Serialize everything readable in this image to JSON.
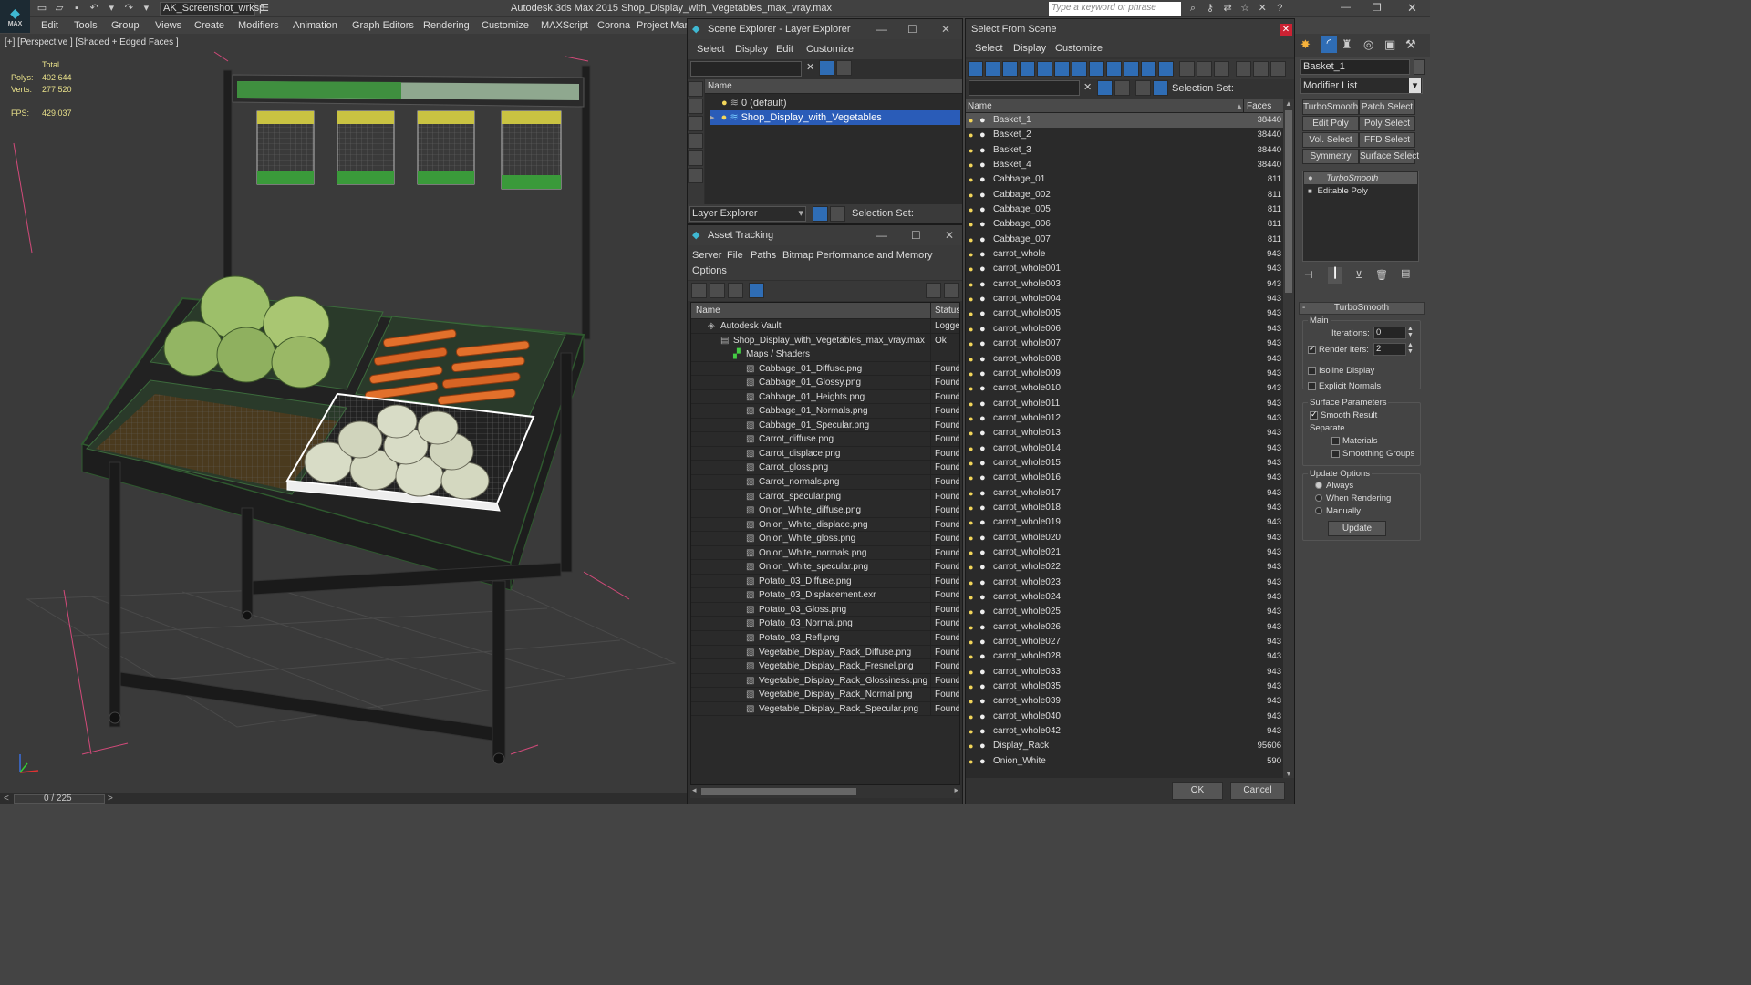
{
  "app": {
    "logo_text": "MAX",
    "workspace": "AK_Screenshot_wrksp",
    "title": "Autodesk 3ds Max 2015    Shop_Display_with_Vegetables_max_vray.max",
    "search_placeholder": "Type a keyword or phrase"
  },
  "menus": [
    "Edit",
    "Tools",
    "Group",
    "Views",
    "Create",
    "Modifiers",
    "Animation",
    "Graph Editors",
    "Rendering",
    "Customize",
    "MAXScript",
    "Corona",
    "Project Man"
  ],
  "viewport": {
    "label": "[+] [Perspective ] [Shaded + Edged Faces ]",
    "stats": {
      "total_label": "Total",
      "polys_label": "Polys:",
      "polys_value": "402 644",
      "verts_label": "Verts:",
      "verts_value": "277 520",
      "fps_label": "FPS:",
      "fps_value": "429,037"
    }
  },
  "statusbar": {
    "timeline": "0 / 225"
  },
  "scene_explorer": {
    "title": "Scene Explorer - Layer Explorer",
    "menus": [
      "Select",
      "Display",
      "Edit",
      "Customize"
    ],
    "column": "Name",
    "layers": [
      "0 (default)",
      "Shop_Display_with_Vegetables"
    ],
    "footer_dropdown": "Layer Explorer",
    "footer_selset": "Selection Set:"
  },
  "asset_tracking": {
    "title": "Asset Tracking",
    "menus": [
      "Server",
      "File",
      "Paths",
      "Bitmap Performance and Memory"
    ],
    "menus2": [
      "Options"
    ],
    "col_name": "Name",
    "col_status": "Status",
    "rows": [
      {
        "name": "Autodesk Vault",
        "status": "Logged",
        "indent": 0
      },
      {
        "name": "Shop_Display_with_Vegetables_max_vray.max",
        "status": "Ok",
        "indent": 1
      },
      {
        "name": "Maps / Shaders",
        "status": "",
        "indent": 2
      },
      {
        "name": "Cabbage_01_Diffuse.png",
        "status": "Found",
        "indent": 3
      },
      {
        "name": "Cabbage_01_Glossy.png",
        "status": "Found",
        "indent": 3
      },
      {
        "name": "Cabbage_01_Heights.png",
        "status": "Found",
        "indent": 3
      },
      {
        "name": "Cabbage_01_Normals.png",
        "status": "Found",
        "indent": 3
      },
      {
        "name": "Cabbage_01_Specular.png",
        "status": "Found",
        "indent": 3
      },
      {
        "name": "Carrot_diffuse.png",
        "status": "Found",
        "indent": 3
      },
      {
        "name": "Carrot_displace.png",
        "status": "Found",
        "indent": 3
      },
      {
        "name": "Carrot_gloss.png",
        "status": "Found",
        "indent": 3
      },
      {
        "name": "Carrot_normals.png",
        "status": "Found",
        "indent": 3
      },
      {
        "name": "Carrot_specular.png",
        "status": "Found",
        "indent": 3
      },
      {
        "name": "Onion_White_diffuse.png",
        "status": "Found",
        "indent": 3
      },
      {
        "name": "Onion_White_displace.png",
        "status": "Found",
        "indent": 3
      },
      {
        "name": "Onion_White_gloss.png",
        "status": "Found",
        "indent": 3
      },
      {
        "name": "Onion_White_normals.png",
        "status": "Found",
        "indent": 3
      },
      {
        "name": "Onion_White_specular.png",
        "status": "Found",
        "indent": 3
      },
      {
        "name": "Potato_03_Diffuse.png",
        "status": "Found",
        "indent": 3
      },
      {
        "name": "Potato_03_Displacement.exr",
        "status": "Found",
        "indent": 3
      },
      {
        "name": "Potato_03_Gloss.png",
        "status": "Found",
        "indent": 3
      },
      {
        "name": "Potato_03_Normal.png",
        "status": "Found",
        "indent": 3
      },
      {
        "name": "Potato_03_Refl.png",
        "status": "Found",
        "indent": 3
      },
      {
        "name": "Vegetable_Display_Rack_Diffuse.png",
        "status": "Found",
        "indent": 3
      },
      {
        "name": "Vegetable_Display_Rack_Fresnel.png",
        "status": "Found",
        "indent": 3
      },
      {
        "name": "Vegetable_Display_Rack_Glossiness.png",
        "status": "Found",
        "indent": 3
      },
      {
        "name": "Vegetable_Display_Rack_Normal.png",
        "status": "Found",
        "indent": 3
      },
      {
        "name": "Vegetable_Display_Rack_Specular.png",
        "status": "Found",
        "indent": 3
      }
    ]
  },
  "select_from_scene": {
    "title": "Select From Scene",
    "menus": [
      "Select",
      "Display",
      "Customize"
    ],
    "selset": "Selection Set:",
    "col_name": "Name",
    "col_faces": "Faces",
    "rows": [
      {
        "name": "Basket_1",
        "faces": "38440"
      },
      {
        "name": "Basket_2",
        "faces": "38440"
      },
      {
        "name": "Basket_3",
        "faces": "38440"
      },
      {
        "name": "Basket_4",
        "faces": "38440"
      },
      {
        "name": "Cabbage_01",
        "faces": "811"
      },
      {
        "name": "Cabbage_002",
        "faces": "811"
      },
      {
        "name": "Cabbage_005",
        "faces": "811"
      },
      {
        "name": "Cabbage_006",
        "faces": "811"
      },
      {
        "name": "Cabbage_007",
        "faces": "811"
      },
      {
        "name": "carrot_whole",
        "faces": "943"
      },
      {
        "name": "carrot_whole001",
        "faces": "943"
      },
      {
        "name": "carrot_whole003",
        "faces": "943"
      },
      {
        "name": "carrot_whole004",
        "faces": "943"
      },
      {
        "name": "carrot_whole005",
        "faces": "943"
      },
      {
        "name": "carrot_whole006",
        "faces": "943"
      },
      {
        "name": "carrot_whole007",
        "faces": "943"
      },
      {
        "name": "carrot_whole008",
        "faces": "943"
      },
      {
        "name": "carrot_whole009",
        "faces": "943"
      },
      {
        "name": "carrot_whole010",
        "faces": "943"
      },
      {
        "name": "carrot_whole011",
        "faces": "943"
      },
      {
        "name": "carrot_whole012",
        "faces": "943"
      },
      {
        "name": "carrot_whole013",
        "faces": "943"
      },
      {
        "name": "carrot_whole014",
        "faces": "943"
      },
      {
        "name": "carrot_whole015",
        "faces": "943"
      },
      {
        "name": "carrot_whole016",
        "faces": "943"
      },
      {
        "name": "carrot_whole017",
        "faces": "943"
      },
      {
        "name": "carrot_whole018",
        "faces": "943"
      },
      {
        "name": "carrot_whole019",
        "faces": "943"
      },
      {
        "name": "carrot_whole020",
        "faces": "943"
      },
      {
        "name": "carrot_whole021",
        "faces": "943"
      },
      {
        "name": "carrot_whole022",
        "faces": "943"
      },
      {
        "name": "carrot_whole023",
        "faces": "943"
      },
      {
        "name": "carrot_whole024",
        "faces": "943"
      },
      {
        "name": "carrot_whole025",
        "faces": "943"
      },
      {
        "name": "carrot_whole026",
        "faces": "943"
      },
      {
        "name": "carrot_whole027",
        "faces": "943"
      },
      {
        "name": "carrot_whole028",
        "faces": "943"
      },
      {
        "name": "carrot_whole033",
        "faces": "943"
      },
      {
        "name": "carrot_whole035",
        "faces": "943"
      },
      {
        "name": "carrot_whole039",
        "faces": "943"
      },
      {
        "name": "carrot_whole040",
        "faces": "943"
      },
      {
        "name": "carrot_whole042",
        "faces": "943"
      },
      {
        "name": "Display_Rack",
        "faces": "95606"
      },
      {
        "name": "Onion_White",
        "faces": "590"
      }
    ],
    "ok": "OK",
    "cancel": "Cancel"
  },
  "command_panel": {
    "object_name": "Basket_1",
    "modifier_list": "Modifier List",
    "buttons": [
      "TurboSmooth",
      "Patch Select",
      "Edit Poly",
      "Poly Select",
      "Vol. Select",
      "FFD Select",
      "Symmetry",
      "Surface Select"
    ],
    "stack": [
      "TurboSmooth",
      "Editable Poly"
    ],
    "rollout_title": "TurboSmooth",
    "main_label": "Main",
    "iterations_label": "Iterations:",
    "iterations_value": "0",
    "render_iters_label": "Render Iters:",
    "render_iters_value": "2",
    "isoline": "Isoline Display",
    "explicit": "Explicit Normals",
    "surface_params": "Surface Parameters",
    "smooth_result": "Smooth Result",
    "separate": "Separate",
    "materials": "Materials",
    "smoothing_groups": "Smoothing Groups",
    "update_options": "Update Options",
    "always": "Always",
    "when_rendering": "When Rendering",
    "manually": "Manually",
    "update": "Update"
  }
}
